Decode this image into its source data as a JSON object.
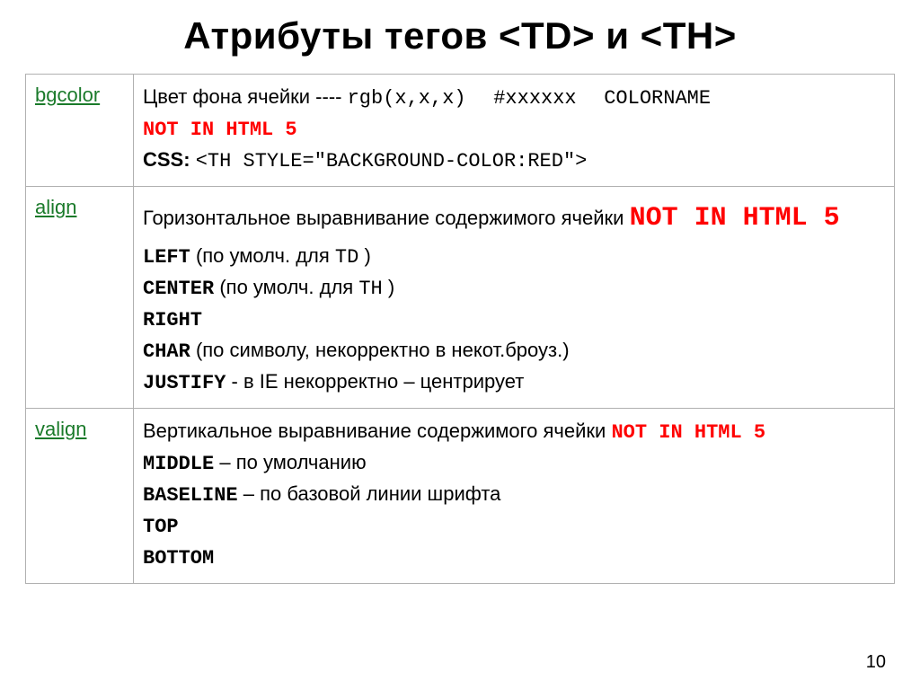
{
  "title": "Атрибуты тегов <TD> и <TH>",
  "pageNumber": "10",
  "rows": {
    "bgcolor": {
      "name": "bgcolor",
      "desc1": "Цвет фона ячейки ---- ",
      "rgb": "rgb(x,x,x)",
      "hex": "#xxxxxx",
      "colorname": "COLORNAME",
      "deprecated": "NOT IN HTML 5",
      "cssLabel": "CSS:",
      "cssCode": "<TH STYLE=\"BACKGROUND-COLOR:RED\">"
    },
    "align": {
      "name": "align",
      "desc1": "Горизонтальное выравнивание содержимого ячейки ",
      "deprecated": "NOT IN HTML 5",
      "left": "LEFT",
      "leftNote": " (по умолч. для ",
      "leftTag": "TD",
      "leftNoteEnd": ")",
      "center": "CENTER",
      "centerNote": " (по умолч. для ",
      "centerTag": "TH",
      "centerNoteEnd": ")",
      "right": "RIGHT",
      "char": "CHAR",
      "charNote": " (по символу, некорректно в некот.броуз.)",
      "justify": "JUSTIFY",
      "justifyNote": " - в IE некорректно – центрирует"
    },
    "valign": {
      "name": "valign",
      "desc1": "Вертикальное выравнивание содержимого ячейки ",
      "deprecated": "NOT IN HTML 5",
      "middle": "MIDDLE",
      "middleNote": " – по умолчанию",
      "baseline": "BASELINE",
      "baselineNote": " – по базовой линии шрифта",
      "top": "TOP",
      "bottom": "BOTTOM"
    }
  }
}
